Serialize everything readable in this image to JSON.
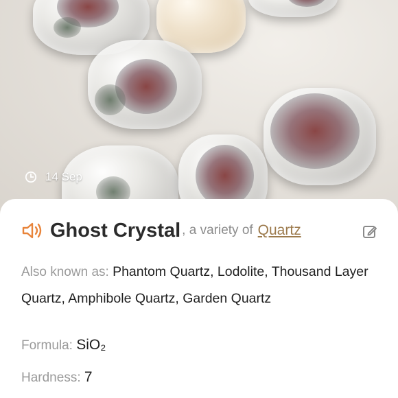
{
  "hero": {
    "date": "14 Sep",
    "clock_icon": "clock-icon"
  },
  "card": {
    "name": "Ghost Crystal",
    "variety_prefix": ", a variety of",
    "variety_link": "Quartz",
    "speaker_icon": "speaker-icon",
    "edit_icon": "edit-icon",
    "accent_color": "#e8843a",
    "link_color": "#9c7a4c",
    "also_known_as_label": "Also known as:",
    "also_known_as_value": "Phantom Quartz, Lodolite, Thousand Layer Quartz, Amphibole Quartz, Garden Quartz",
    "formula_label": "Formula:",
    "formula_value": "SiO₂",
    "hardness_label": "Hardness:",
    "hardness_value": "7"
  }
}
